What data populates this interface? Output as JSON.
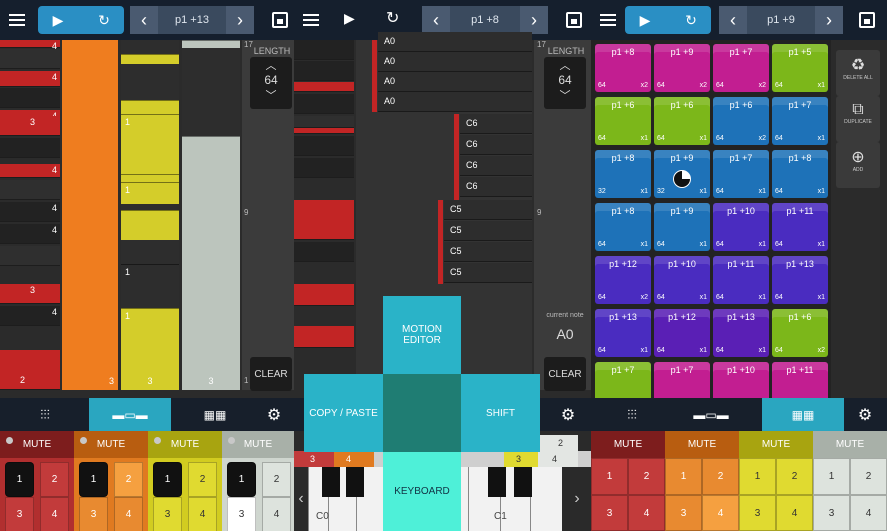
{
  "panels": [
    {
      "id": "pattern-editor",
      "pattern": "p1 +13",
      "length_label": "LENGTH",
      "length_value": "64",
      "clear_label": "CLEAR",
      "ruler_labels": [
        "17",
        "9",
        "1"
      ],
      "key_numbers": [
        "4",
        "4",
        "4",
        "3",
        "4",
        "4",
        "4",
        "3",
        "4",
        "2"
      ],
      "lane_numbers": [
        "1",
        "1",
        "3",
        "1",
        "1",
        "1",
        "3",
        "4",
        "3",
        "3"
      ],
      "mute_label": "MUTE",
      "channel_values": [
        "1",
        "2",
        "3",
        "4"
      ],
      "colors": {
        "lane1": "#ef7d1f",
        "lane2": "#d4cd2a",
        "lane3": "#bcc5bd",
        "red": "#c22525"
      }
    },
    {
      "id": "note-editor",
      "pattern": "p1 +8",
      "length_label": "LENGTH",
      "length_value": "64",
      "clear_label": "CLEAR",
      "current_note_label": "current note",
      "current_note_value": "A0",
      "ruler_labels": [
        "17",
        "9"
      ],
      "notes_a0": [
        "A0",
        "A0",
        "A0",
        "A0"
      ],
      "notes_c6": [
        "C6",
        "C6",
        "C6",
        "C6"
      ],
      "notes_c5": [
        "C5",
        "C5",
        "C5",
        "C5"
      ],
      "radial_menu": {
        "motion_editor": "MOTION EDITOR",
        "copy_paste": "COPY / PASTE",
        "shift": "SHIFT",
        "keyboard": "KEYBOARD"
      },
      "keyboard_labels": {
        "left": "C0",
        "right": "C1"
      },
      "keyboard_strip": [
        "3",
        "4",
        "3",
        "4",
        "2"
      ]
    },
    {
      "id": "pattern-list",
      "pattern": "p1 +9",
      "side_buttons": [
        "DELETE ALL",
        "DUPLICATE",
        "ADD"
      ],
      "mute_label": "MUTE",
      "channel_values": [
        "1",
        "2",
        "3",
        "4"
      ],
      "patterns": [
        [
          {
            "n": "p1 +8",
            "l": "64",
            "c": "x2",
            "col": "#c21e91"
          },
          {
            "n": "p1 +9",
            "l": "64",
            "c": "x2",
            "col": "#c21e91"
          },
          {
            "n": "p1 +7",
            "l": "64",
            "c": "x2",
            "col": "#c21e91"
          },
          {
            "n": "p1 +5",
            "l": "64",
            "c": "x1",
            "col": "#7cb71a"
          }
        ],
        [
          {
            "n": "p1 +6",
            "l": "64",
            "c": "x1",
            "col": "#7cb71a"
          },
          {
            "n": "p1 +6",
            "l": "64",
            "c": "x1",
            "col": "#7cb71a"
          },
          {
            "n": "p1 +6",
            "l": "64",
            "c": "x2",
            "col": "#1e72b8"
          },
          {
            "n": "p1 +7",
            "l": "64",
            "c": "x1",
            "col": "#1e72b8"
          }
        ],
        [
          {
            "n": "p1 +8",
            "l": "32",
            "c": "x1",
            "col": "#1e72b8"
          },
          {
            "n": "p1 +9",
            "l": "32",
            "c": "x1",
            "col": "#1e72b8",
            "pie": true
          },
          {
            "n": "p1 +7",
            "l": "64",
            "c": "x1",
            "col": "#1e72b8"
          },
          {
            "n": "p1 +8",
            "l": "64",
            "c": "x1",
            "col": "#1e72b8"
          }
        ],
        [
          {
            "n": "p1 +8",
            "l": "64",
            "c": "x1",
            "col": "#1e72b8"
          },
          {
            "n": "p1 +9",
            "l": "64",
            "c": "x1",
            "col": "#1e72b8"
          },
          {
            "n": "p1 +10",
            "l": "64",
            "c": "x1",
            "col": "#4a2cc0"
          },
          {
            "n": "p1 +11",
            "l": "64",
            "c": "x1",
            "col": "#4a2cc0"
          }
        ],
        [
          {
            "n": "p1 +12",
            "l": "64",
            "c": "x2",
            "col": "#4a2cc0"
          },
          {
            "n": "p1 +10",
            "l": "64",
            "c": "x1",
            "col": "#4a2cc0"
          },
          {
            "n": "p1 +11",
            "l": "64",
            "c": "x1",
            "col": "#4a2cc0"
          },
          {
            "n": "p1 +13",
            "l": "64",
            "c": "x1",
            "col": "#4a2cc0"
          }
        ],
        [
          {
            "n": "p1 +13",
            "l": "64",
            "c": "x1",
            "col": "#4a2cc0"
          },
          {
            "n": "p1 +12",
            "l": "64",
            "c": "x1",
            "col": "#5a1fb5"
          },
          {
            "n": "p1 +13",
            "l": "64",
            "c": "x1",
            "col": "#5a1fb5"
          },
          {
            "n": "p1 +6",
            "l": "64",
            "c": "x2",
            "col": "#7cb71a"
          }
        ],
        [
          {
            "n": "p1 +7",
            "l": "",
            "c": "",
            "col": "#7cb71a"
          },
          {
            "n": "p1 +7",
            "l": "",
            "c": "",
            "col": "#c21e91"
          },
          {
            "n": "p1 +10",
            "l": "",
            "c": "",
            "col": "#c21e91"
          },
          {
            "n": "p1 +11",
            "l": "",
            "c": "",
            "col": "#c21e91"
          }
        ]
      ]
    }
  ]
}
